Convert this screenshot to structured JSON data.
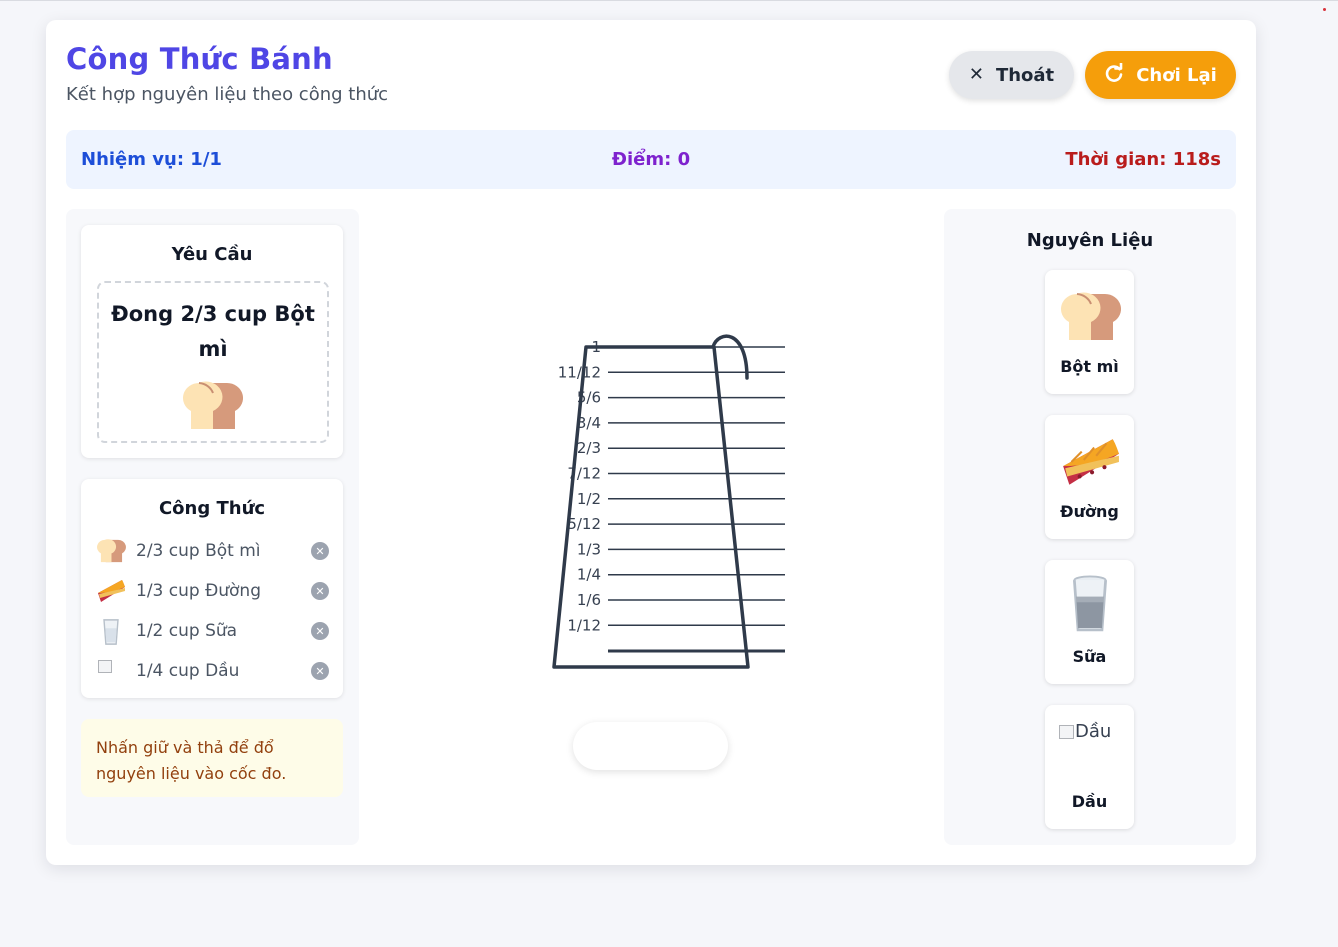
{
  "app": {
    "title": "Công Thức Bánh",
    "subtitle": "Kết hợp nguyên liệu theo công thức"
  },
  "header": {
    "exit_label": "Thoát",
    "replay_label": "Chơi Lại"
  },
  "status": {
    "mission": "Nhiệm vụ: 1/1",
    "score": "Điểm: 0",
    "time": "Thời gian: 118s"
  },
  "requirement": {
    "heading": "Yêu Cầu",
    "line1": "Đong 2/3 cup Bột",
    "line2": "mì",
    "icon": "bread-icon"
  },
  "recipe": {
    "heading": "Công Thức",
    "items": [
      {
        "text": "2/3 cup Bột mì",
        "icon": "bread-icon"
      },
      {
        "text": "1/3 cup Đường",
        "icon": "pie-icon"
      },
      {
        "text": "1/2 cup Sữa",
        "icon": "milk-glass-icon"
      },
      {
        "text": "1/4 cup Dầu",
        "icon": "broken-image-icon"
      }
    ]
  },
  "hint": {
    "line1": "Nhấn giữ và thả để đổ",
    "line2": "nguyên liệu vào cốc đo."
  },
  "cup": {
    "fill_level": 0,
    "ticks": [
      "1",
      "11/12",
      "5/6",
      "3/4",
      "2/3",
      "7/12",
      "1/2",
      "5/12",
      "1/3",
      "1/4",
      "1/6",
      "1/12"
    ]
  },
  "ingredients": {
    "heading": "Nguyên Liệu",
    "items": [
      {
        "label": "Bột mì",
        "icon": "bread-icon"
      },
      {
        "label": "Đường",
        "icon": "pie-icon"
      },
      {
        "label": "Sữa",
        "icon": "milk-glass-icon"
      },
      {
        "label": "Dầu",
        "icon": "broken-image-icon",
        "alt": "Dầu"
      }
    ]
  },
  "colors": {
    "title": "#4f46e5",
    "replay_button": "#f59e0b",
    "status_bg": "#eef4ff",
    "mission_text": "#1d4ed8",
    "score_text": "#7e22ce",
    "time_text": "#b91c1c",
    "cup_stroke": "#2f3a4a",
    "hint_bg": "#fefce8"
  }
}
